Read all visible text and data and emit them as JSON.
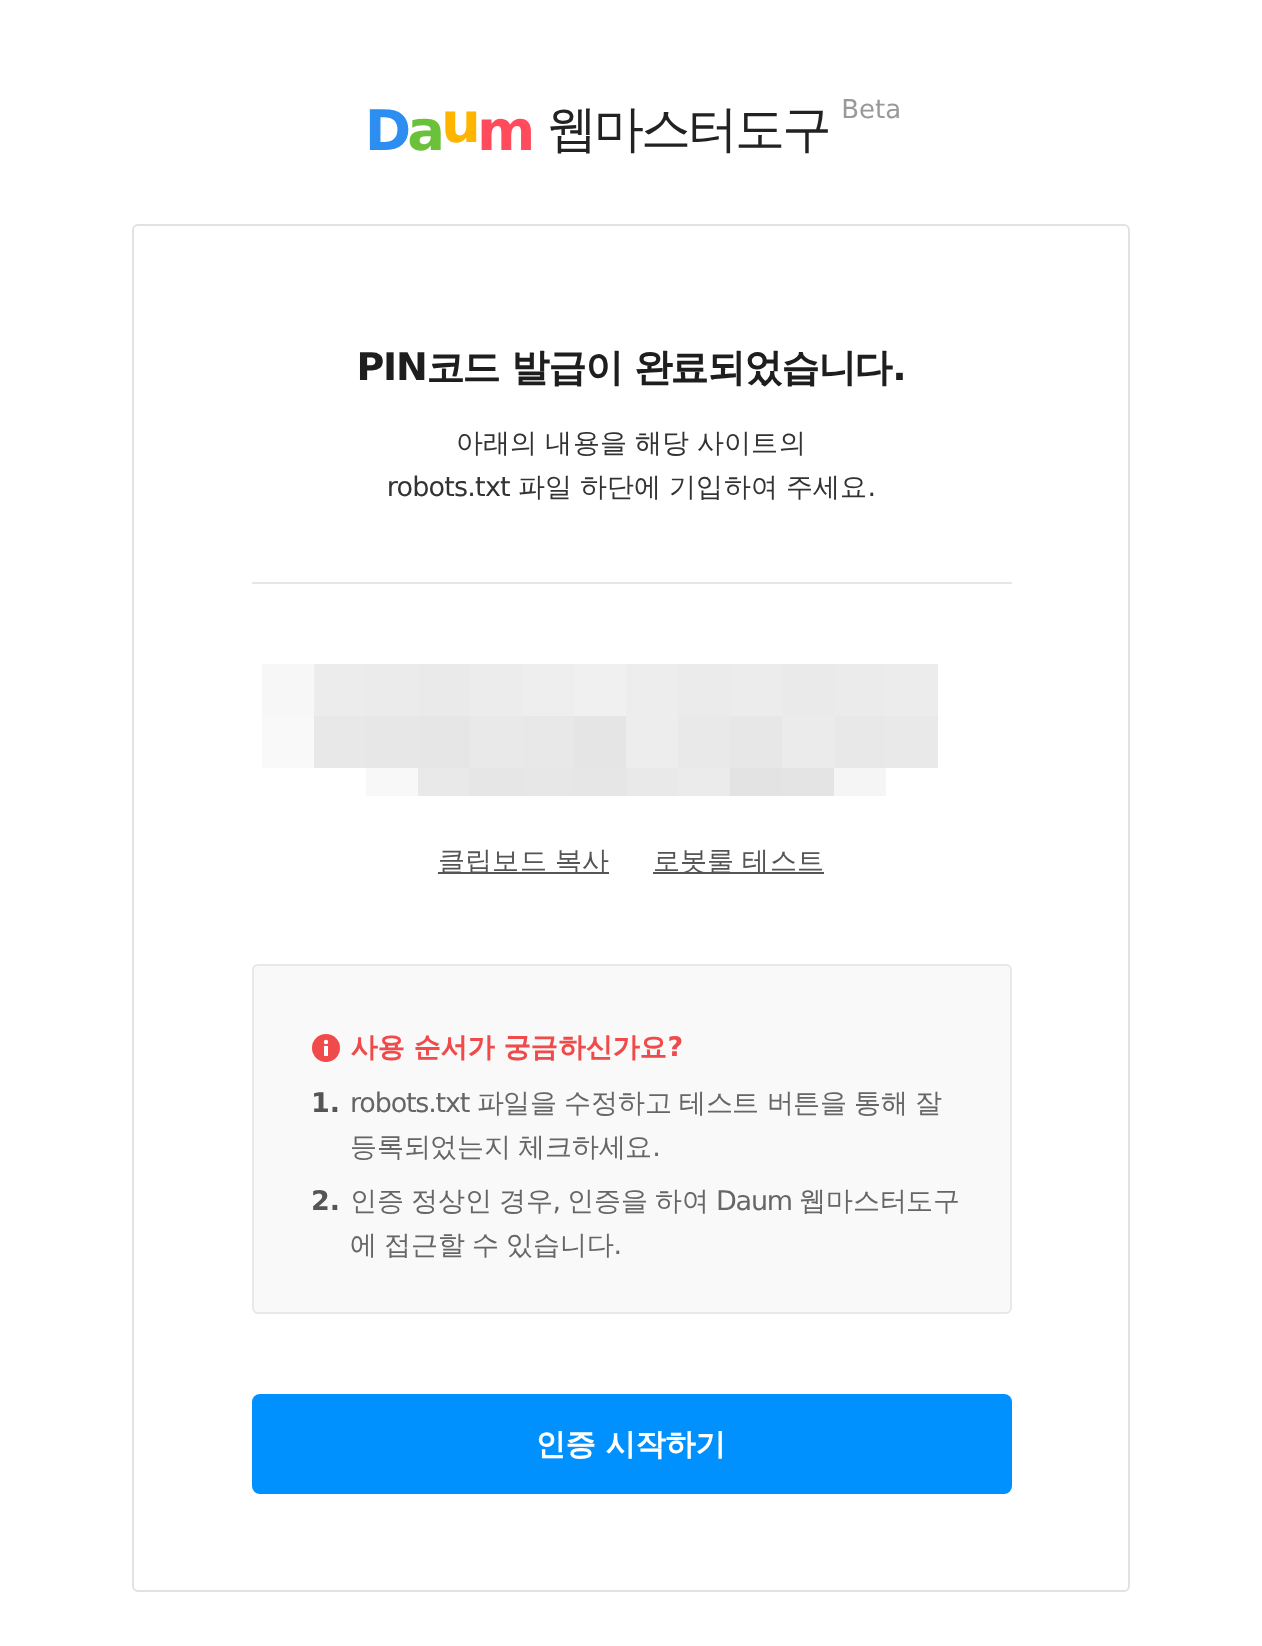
{
  "logo": {
    "letters": [
      {
        "text": "D",
        "color": "#2b8ef0"
      },
      {
        "text": "a",
        "color": "#6cc13a"
      },
      {
        "text": "u",
        "color": "#ffb400"
      },
      {
        "text": "m",
        "color": "#ff4b5c"
      }
    ],
    "product": "웹마스터도구",
    "badge": "Beta"
  },
  "card": {
    "title": "PIN코드 발급이 완료되었습니다.",
    "description": "아래의 내용을 해당 사이트의\nrobots.txt 파일 하단에 기입하여 주세요.",
    "links": [
      "클립보드 복사",
      "로봇룰 테스트"
    ],
    "help": {
      "title": "사용 순서가 궁금하신가요?",
      "steps": [
        {
          "number": "1.",
          "text": "robots.txt 파일을 수정하고 테스트 버튼을 통해 잘 등록되었는지 체크하세요."
        },
        {
          "number": "2.",
          "text": "인증 정상인 경우, 인증을 하여 Daum 웹마스터도구에 접근할 수 있습니다."
        }
      ]
    },
    "button": "인증 시작하기"
  }
}
